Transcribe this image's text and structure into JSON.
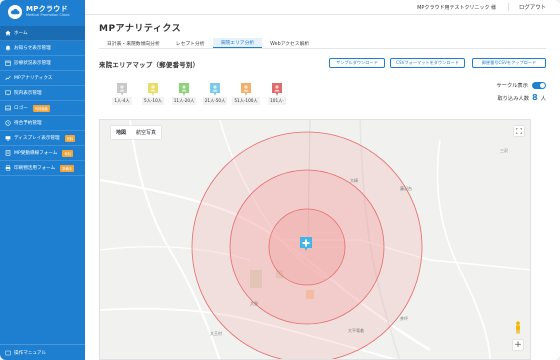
{
  "brand": {
    "name": "MPクラウド",
    "subtitle": "Medical Promotion Cloud",
    "color": "#1e7fd0"
  },
  "header": {
    "account": "MPクラウド用テストクリニック 様",
    "logout": "ログアウト"
  },
  "sidebar": {
    "items": [
      {
        "label": "ホーム",
        "icon": "home-icon",
        "active": true
      },
      {
        "label": "お知らせ表示管理",
        "icon": "bell-icon"
      },
      {
        "label": "診療状況表示管理",
        "icon": "calendar-icon"
      },
      {
        "label": "MPアナリティクス",
        "icon": "chart-icon"
      },
      {
        "label": "院内表示管理",
        "icon": "monitor-icon"
      },
      {
        "label": "ロゴー",
        "icon": "image-icon",
        "badge": "有料機能"
      },
      {
        "label": "待合予約管理",
        "icon": "clock-icon"
      },
      {
        "label": "ディスプレイ表示管理",
        "icon": "display-icon",
        "badge": "有料"
      },
      {
        "label": "MP受動導線フォーム",
        "icon": "form-icon",
        "badge": "有料"
      },
      {
        "label": "印刷物活用フォーム",
        "icon": "print-icon",
        "badge": "準備中"
      }
    ],
    "footer": "操作マニュアル"
  },
  "main": {
    "title": "MPアナリティクス",
    "tabs": [
      {
        "label": "日計表・来院数傾向分析",
        "active": false
      },
      {
        "label": "レセプト分析",
        "active": false
      },
      {
        "label": "来院エリア分析",
        "active": true
      },
      {
        "label": "Webアクセス解析",
        "active": false
      }
    ],
    "section_title": "来院エリアマップ（郵便番号別）",
    "buttons": {
      "sample_download": "サンプルダウンロード",
      "csv_format_download": "CSVフォーマットをダウンロード",
      "csv_upload": "郵便番号CSVをアップロード"
    },
    "legend": [
      {
        "label": "1人-4人",
        "color": "#c8c8c8"
      },
      {
        "label": "5人-10人",
        "color": "#e9dd6a"
      },
      {
        "label": "11人-20人",
        "color": "#8fd07c"
      },
      {
        "label": "21人-50人",
        "color": "#7ec9e6"
      },
      {
        "label": "51人-100人",
        "color": "#f3b06b"
      },
      {
        "label": "101人-",
        "color": "#e36a6a"
      }
    ],
    "circle_toggle_label": "サークル表示",
    "circle_toggle_on": true,
    "load_count_label": "取り込み人数",
    "load_count_value": "8",
    "load_count_unit": "人"
  },
  "map": {
    "types": [
      "地図",
      "航空写真"
    ],
    "active_type": "地図",
    "labels": [
      "大平竜着",
      "三沢",
      "大崎",
      "大平竜着",
      "藤沢台",
      "茶坪",
      "大泉",
      "大王村"
    ],
    "circle_color": "#f29a9a"
  }
}
